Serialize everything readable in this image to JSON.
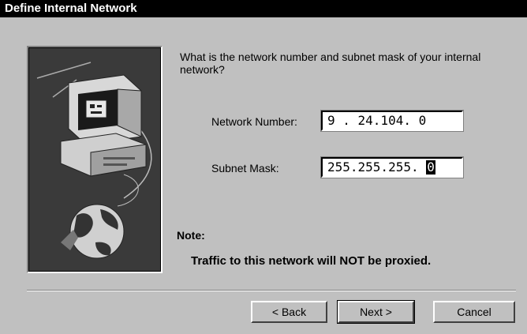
{
  "window": {
    "title": "Define Internal Network"
  },
  "image_panel": {
    "icon": "computer-globe-network-illustration"
  },
  "question": "What is the network number and subnet mask of your internal network?",
  "network_number": {
    "label": "Network Number:",
    "value": "9 . 24.104. 0"
  },
  "subnet_mask": {
    "label": "Subnet Mask:",
    "value_prefix": "255.255.255. ",
    "value_selected": "0"
  },
  "note": {
    "label": "Note:",
    "text": "Traffic to this network will NOT be proxied."
  },
  "buttons": {
    "back": "< Back",
    "next": "Next >",
    "cancel": "Cancel"
  }
}
